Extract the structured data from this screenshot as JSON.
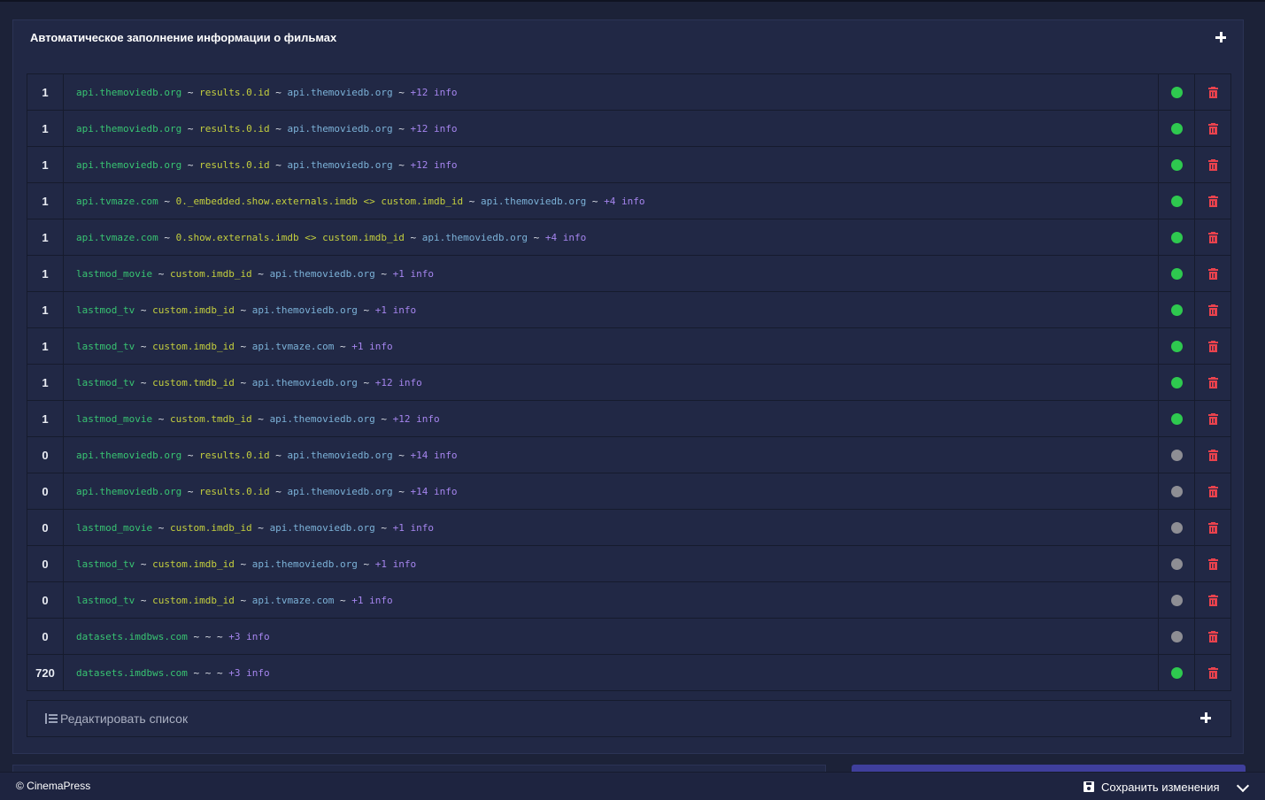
{
  "panel": {
    "title": "Автоматическое заполнение информации о фильмах"
  },
  "colors": {
    "background": "#1c2238",
    "panel": "#212845",
    "status_active": "#2ec94f",
    "status_inactive": "#8e8e94",
    "delete": "#e8424d",
    "segment_colors": [
      "#38c472",
      "#c4cf3e",
      "#7cb2d8",
      "#a585ee"
    ]
  },
  "rules": [
    {
      "count": "1",
      "status": "active",
      "segments": [
        {
          "t": "api.themoviedb.org",
          "c": 0
        },
        {
          "t": " ~ ",
          "c": "w"
        },
        {
          "t": "results.0.id",
          "c": 1
        },
        {
          "t": " ~ ",
          "c": "w"
        },
        {
          "t": "api.themoviedb.org",
          "c": 2
        },
        {
          "t": " ~ ",
          "c": "w"
        },
        {
          "t": "+12 info",
          "c": 3
        }
      ]
    },
    {
      "count": "1",
      "status": "active",
      "segments": [
        {
          "t": "api.themoviedb.org",
          "c": 0
        },
        {
          "t": " ~ ",
          "c": "w"
        },
        {
          "t": "results.0.id",
          "c": 1
        },
        {
          "t": " ~ ",
          "c": "w"
        },
        {
          "t": "api.themoviedb.org",
          "c": 2
        },
        {
          "t": " ~ ",
          "c": "w"
        },
        {
          "t": "+12 info",
          "c": 3
        }
      ]
    },
    {
      "count": "1",
      "status": "active",
      "segments": [
        {
          "t": "api.themoviedb.org",
          "c": 0
        },
        {
          "t": " ~ ",
          "c": "w"
        },
        {
          "t": "results.0.id",
          "c": 1
        },
        {
          "t": " ~ ",
          "c": "w"
        },
        {
          "t": "api.themoviedb.org",
          "c": 2
        },
        {
          "t": " ~ ",
          "c": "w"
        },
        {
          "t": "+12 info",
          "c": 3
        }
      ]
    },
    {
      "count": "1",
      "status": "active",
      "segments": [
        {
          "t": "api.tvmaze.com",
          "c": 0
        },
        {
          "t": " ~ ",
          "c": "w"
        },
        {
          "t": "0._embedded.show.externals.imdb <> custom.imdb_id",
          "c": 1
        },
        {
          "t": " ~ ",
          "c": "w"
        },
        {
          "t": "api.themoviedb.org",
          "c": 2
        },
        {
          "t": " ~ ",
          "c": "w"
        },
        {
          "t": "+4 info",
          "c": 3
        }
      ]
    },
    {
      "count": "1",
      "status": "active",
      "segments": [
        {
          "t": "api.tvmaze.com",
          "c": 0
        },
        {
          "t": " ~ ",
          "c": "w"
        },
        {
          "t": "0.show.externals.imdb <> custom.imdb_id",
          "c": 1
        },
        {
          "t": " ~ ",
          "c": "w"
        },
        {
          "t": "api.themoviedb.org",
          "c": 2
        },
        {
          "t": " ~ ",
          "c": "w"
        },
        {
          "t": "+4 info",
          "c": 3
        }
      ]
    },
    {
      "count": "1",
      "status": "active",
      "segments": [
        {
          "t": "lastmod_movie",
          "c": 0
        },
        {
          "t": " ~ ",
          "c": "w"
        },
        {
          "t": "custom.imdb_id",
          "c": 1
        },
        {
          "t": " ~ ",
          "c": "w"
        },
        {
          "t": "api.themoviedb.org",
          "c": 2
        },
        {
          "t": " ~ ",
          "c": "w"
        },
        {
          "t": "+1 info",
          "c": 3
        }
      ]
    },
    {
      "count": "1",
      "status": "active",
      "segments": [
        {
          "t": "lastmod_tv",
          "c": 0
        },
        {
          "t": " ~ ",
          "c": "w"
        },
        {
          "t": "custom.imdb_id",
          "c": 1
        },
        {
          "t": " ~ ",
          "c": "w"
        },
        {
          "t": "api.themoviedb.org",
          "c": 2
        },
        {
          "t": " ~ ",
          "c": "w"
        },
        {
          "t": "+1 info",
          "c": 3
        }
      ]
    },
    {
      "count": "1",
      "status": "active",
      "segments": [
        {
          "t": "lastmod_tv",
          "c": 0
        },
        {
          "t": " ~ ",
          "c": "w"
        },
        {
          "t": "custom.imdb_id",
          "c": 1
        },
        {
          "t": " ~ ",
          "c": "w"
        },
        {
          "t": "api.tvmaze.com",
          "c": 2
        },
        {
          "t": " ~ ",
          "c": "w"
        },
        {
          "t": "+1 info",
          "c": 3
        }
      ]
    },
    {
      "count": "1",
      "status": "active",
      "segments": [
        {
          "t": "lastmod_tv",
          "c": 0
        },
        {
          "t": " ~ ",
          "c": "w"
        },
        {
          "t": "custom.tmdb_id",
          "c": 1
        },
        {
          "t": " ~ ",
          "c": "w"
        },
        {
          "t": "api.themoviedb.org",
          "c": 2
        },
        {
          "t": " ~ ",
          "c": "w"
        },
        {
          "t": "+12 info",
          "c": 3
        }
      ]
    },
    {
      "count": "1",
      "status": "active",
      "segments": [
        {
          "t": "lastmod_movie",
          "c": 0
        },
        {
          "t": " ~ ",
          "c": "w"
        },
        {
          "t": "custom.tmdb_id",
          "c": 1
        },
        {
          "t": " ~ ",
          "c": "w"
        },
        {
          "t": "api.themoviedb.org",
          "c": 2
        },
        {
          "t": " ~ ",
          "c": "w"
        },
        {
          "t": "+12 info",
          "c": 3
        }
      ]
    },
    {
      "count": "0",
      "status": "inactive",
      "segments": [
        {
          "t": "api.themoviedb.org",
          "c": 0
        },
        {
          "t": " ~ ",
          "c": "w"
        },
        {
          "t": "results.0.id",
          "c": 1
        },
        {
          "t": " ~ ",
          "c": "w"
        },
        {
          "t": "api.themoviedb.org",
          "c": 2
        },
        {
          "t": " ~ ",
          "c": "w"
        },
        {
          "t": "+14 info",
          "c": 3
        }
      ]
    },
    {
      "count": "0",
      "status": "inactive",
      "segments": [
        {
          "t": "api.themoviedb.org",
          "c": 0
        },
        {
          "t": " ~ ",
          "c": "w"
        },
        {
          "t": "results.0.id",
          "c": 1
        },
        {
          "t": " ~ ",
          "c": "w"
        },
        {
          "t": "api.themoviedb.org",
          "c": 2
        },
        {
          "t": " ~ ",
          "c": "w"
        },
        {
          "t": "+14 info",
          "c": 3
        }
      ]
    },
    {
      "count": "0",
      "status": "inactive",
      "segments": [
        {
          "t": "lastmod_movie",
          "c": 0
        },
        {
          "t": " ~ ",
          "c": "w"
        },
        {
          "t": "custom.imdb_id",
          "c": 1
        },
        {
          "t": " ~ ",
          "c": "w"
        },
        {
          "t": "api.themoviedb.org",
          "c": 2
        },
        {
          "t": " ~ ",
          "c": "w"
        },
        {
          "t": "+1 info",
          "c": 3
        }
      ]
    },
    {
      "count": "0",
      "status": "inactive",
      "segments": [
        {
          "t": "lastmod_tv",
          "c": 0
        },
        {
          "t": " ~ ",
          "c": "w"
        },
        {
          "t": "custom.imdb_id",
          "c": 1
        },
        {
          "t": " ~ ",
          "c": "w"
        },
        {
          "t": "api.themoviedb.org",
          "c": 2
        },
        {
          "t": " ~ ",
          "c": "w"
        },
        {
          "t": "+1 info",
          "c": 3
        }
      ]
    },
    {
      "count": "0",
      "status": "inactive",
      "segments": [
        {
          "t": "lastmod_tv",
          "c": 0
        },
        {
          "t": " ~ ",
          "c": "w"
        },
        {
          "t": "custom.imdb_id",
          "c": 1
        },
        {
          "t": " ~ ",
          "c": "w"
        },
        {
          "t": "api.tvmaze.com",
          "c": 2
        },
        {
          "t": " ~ ",
          "c": "w"
        },
        {
          "t": "+1 info",
          "c": 3
        }
      ]
    },
    {
      "count": "0",
      "status": "inactive",
      "segments": [
        {
          "t": "datasets.imdbws.com",
          "c": 0
        },
        {
          "t": " ~ ~ ~ ",
          "c": "w"
        },
        {
          "t": "+3 info",
          "c": 3
        }
      ]
    },
    {
      "count": "720",
      "status": "active",
      "segments": [
        {
          "t": "datasets.imdbws.com",
          "c": 0
        },
        {
          "t": " ~ ~ ~ ",
          "c": "w"
        },
        {
          "t": "+3 info",
          "c": 3
        }
      ]
    }
  ],
  "edit_list": {
    "label": "Редактировать список",
    "icon": "list-ordered-icon"
  },
  "footer": {
    "copyright": "© CinemaPress",
    "save_label": "Сохранить изменения",
    "save_icon": "floppy-disk-icon",
    "toggle_icon": "chevron-down-icon"
  }
}
